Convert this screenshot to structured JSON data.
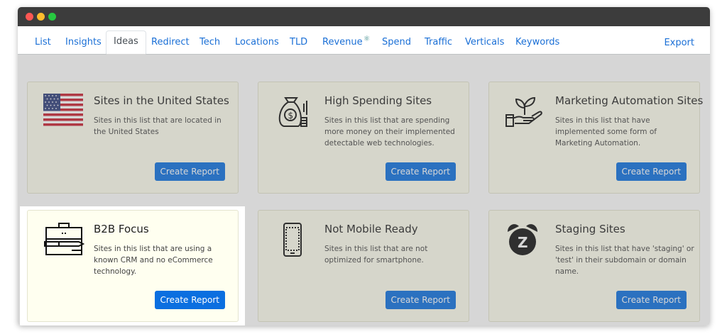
{
  "window": {
    "controls": [
      "close",
      "minimize",
      "maximize"
    ]
  },
  "tabs": [
    {
      "label": "List",
      "active": false
    },
    {
      "label": "Insights",
      "active": false
    },
    {
      "label": "Ideas",
      "active": true
    },
    {
      "label": "Redirect",
      "active": false
    },
    {
      "label": "Tech",
      "active": false
    },
    {
      "label": "Locations",
      "active": false
    },
    {
      "label": "TLD",
      "active": false
    },
    {
      "label": "Revenue",
      "active": false,
      "icon": "revenue-icon"
    },
    {
      "label": "Spend",
      "active": false
    },
    {
      "label": "Traffic",
      "active": false
    },
    {
      "label": "Verticals",
      "active": false
    },
    {
      "label": "Keywords",
      "active": false
    }
  ],
  "export_label": "Export",
  "cards": [
    {
      "icon": "us-flag-icon",
      "title": "Sites in the United States",
      "desc": "Sites in this list that are located in the United States",
      "button": "Create Report",
      "highlighted": false
    },
    {
      "icon": "money-bag-icon",
      "title": "High Spending Sites",
      "desc": "Sites in this list that are spending more money on their implemented detectable web technologies.",
      "button": "Create Report",
      "highlighted": false
    },
    {
      "icon": "plant-hand-icon",
      "title": "Marketing Automation Sites",
      "desc": "Sites in this list that have implemented some form of Marketing Automation.",
      "button": "Create Report",
      "highlighted": false
    },
    {
      "icon": "briefcase-icon",
      "title": "B2B Focus",
      "desc": "Sites in this list that are using a known CRM and no eCommerce technology.",
      "button": "Create Report",
      "highlighted": true
    },
    {
      "icon": "mobile-phone-icon",
      "title": "Not Mobile Ready",
      "desc": "Sites in this list that are not optimized for smartphone.",
      "button": "Create Report",
      "highlighted": false
    },
    {
      "icon": "alarm-clock-icon",
      "title": "Staging Sites",
      "desc": "Sites in this list that have 'staging' or 'test' in their subdomain or domain name.",
      "button": "Create Report",
      "highlighted": false
    }
  ],
  "colors": {
    "link": "#1a6fd6",
    "button": "#0b6fe0",
    "card_bg": "#fffff0",
    "titlebar": "#3c3c3c"
  }
}
